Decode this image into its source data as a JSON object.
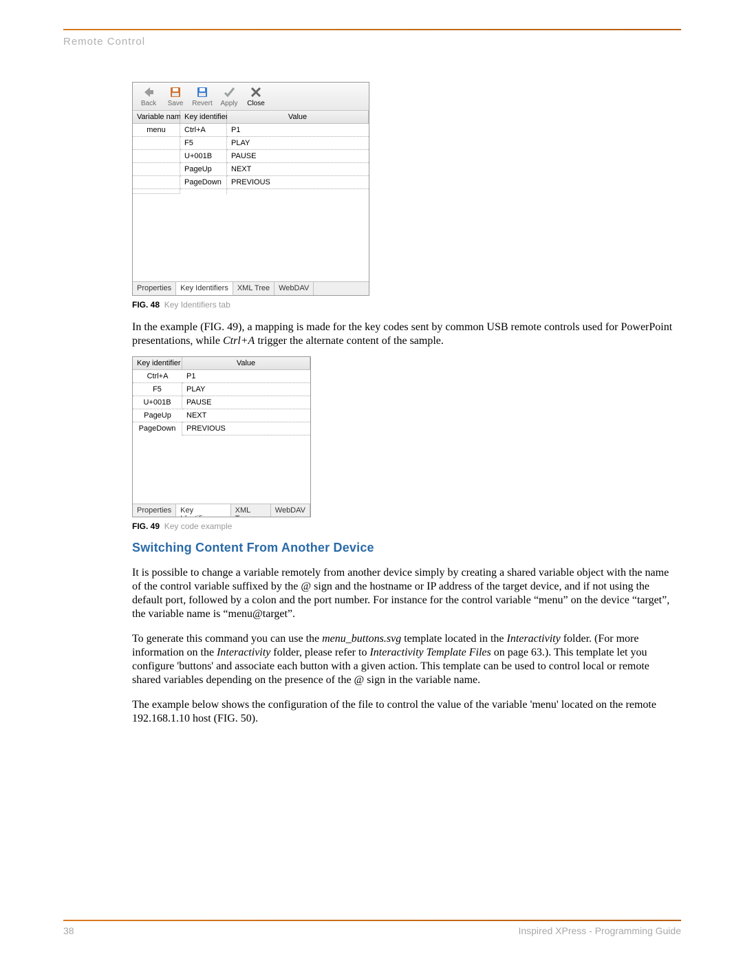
{
  "section_title": "Remote Control",
  "fig48": {
    "toolbar": {
      "back": "Back",
      "save": "Save",
      "revert": "Revert",
      "apply": "Apply",
      "close": "Close"
    },
    "headers": {
      "c0": "Variable name",
      "c1": "Key identifier",
      "c2": "Value"
    },
    "rows": [
      {
        "name": "menu",
        "key": "Ctrl+A",
        "val": "P1"
      },
      {
        "name": "",
        "key": "F5",
        "val": "PLAY"
      },
      {
        "name": "",
        "key": "U+001B",
        "val": "PAUSE"
      },
      {
        "name": "",
        "key": "PageUp",
        "val": "NEXT"
      },
      {
        "name": "",
        "key": "PageDown",
        "val": "PREVIOUS"
      },
      {
        "name": "",
        "key": "",
        "val": ""
      }
    ],
    "tabs": {
      "t0": "Properties",
      "t1": "Key Identifiers",
      "t2": "XML Tree",
      "t3": "WebDAV"
    }
  },
  "cap48": {
    "label": "FIG. 48",
    "text": "Key Identifiers tab"
  },
  "para1": {
    "a": "In the example (FIG. 49), a mapping is made for the key codes sent by common USB remote controls used for PowerPoint presentations, while ",
    "b": "Ctrl+A",
    "c": " trigger the alternate content of the sample."
  },
  "fig49": {
    "headers": {
      "c0": "Key identifier",
      "c1": "Value"
    },
    "rows": [
      {
        "key": "Ctrl+A",
        "val": "P1"
      },
      {
        "key": "F5",
        "val": "PLAY"
      },
      {
        "key": "U+001B",
        "val": "PAUSE"
      },
      {
        "key": "PageUp",
        "val": "NEXT"
      },
      {
        "key": "PageDown",
        "val": "PREVIOUS"
      }
    ],
    "tabs": {
      "t0": "Properties",
      "t1": "Key Identifiers",
      "t2": "XML Tree",
      "t3": "WebDAV"
    }
  },
  "cap49": {
    "label": "FIG. 49",
    "text": "Key code example"
  },
  "subhead": "Switching Content From Another Device",
  "para2": "It is possible to change a variable remotely from another device simply by creating a shared variable object with the name of the control variable suffixed by the @ sign and the hostname or IP address of the target device, and if not using the default port, followed by a colon and the port number. For instance for the control variable “menu” on the device “target”, the variable name is “menu@target”.",
  "para3": {
    "a": "To generate this command you can use the ",
    "b": "menu_buttons.svg",
    "c": " template located in the ",
    "d": "Interactivity",
    "e": " folder. (For more information on the ",
    "f": "Interactivity",
    "g": " folder, please refer to ",
    "h": "Interactivity Template Files ",
    "i": " on page 63.). This template let you configure 'buttons' and associate each button with a given action. This template can be used to control local or remote shared variables depending on the presence of the @ sign in the variable name."
  },
  "para4": "The example below shows the configuration of the file to control the value of the variable 'menu' located on the remote 192.168.1.10 host (FIG. 50).",
  "footer": {
    "page": "38",
    "book": "Inspired XPress - Programming Guide"
  }
}
